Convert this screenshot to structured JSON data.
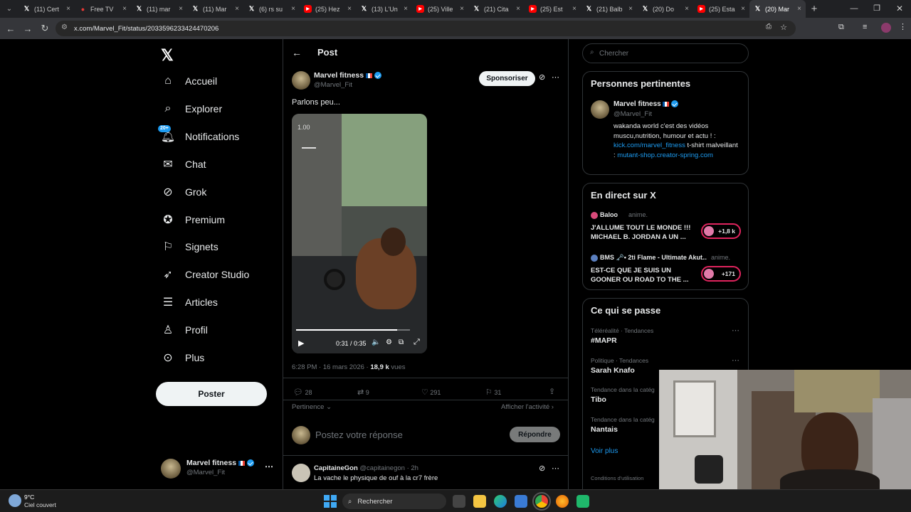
{
  "browser": {
    "tabs": [
      {
        "icon": "x-logo",
        "title": "(11) Cert"
      },
      {
        "icon": "freetv",
        "title": "Free TV"
      },
      {
        "icon": "x-logo",
        "title": "(11) mar"
      },
      {
        "icon": "x-logo",
        "title": "(11) Mar"
      },
      {
        "icon": "x-logo",
        "title": "(6) rs su"
      },
      {
        "icon": "youtube",
        "title": "(25) Hez"
      },
      {
        "icon": "x-logo",
        "title": "(13) L'Un"
      },
      {
        "icon": "youtube",
        "title": "(25) Ville"
      },
      {
        "icon": "x-logo",
        "title": "(21) Cita"
      },
      {
        "icon": "youtube",
        "title": "(25) Est"
      },
      {
        "icon": "x-logo",
        "title": "(21) Balb"
      },
      {
        "icon": "x-logo",
        "title": "(20) Do"
      },
      {
        "icon": "youtube",
        "title": "(25) Esta"
      },
      {
        "icon": "x-logo",
        "title": "(20) Mar"
      }
    ],
    "url": "x.com/Marvel_Fit/status/2033596233424470206"
  },
  "sidebar": {
    "items": [
      {
        "label": "Accueil",
        "icon": "home-icon"
      },
      {
        "label": "Explorer",
        "icon": "search-icon"
      },
      {
        "label": "Notifications",
        "icon": "bell-icon",
        "badge": "20+"
      },
      {
        "label": "Chat",
        "icon": "mail-icon"
      },
      {
        "label": "Grok",
        "icon": "grok-icon"
      },
      {
        "label": "Premium",
        "icon": "premium-icon"
      },
      {
        "label": "Signets",
        "icon": "bookmark-icon"
      },
      {
        "label": "Creator Studio",
        "icon": "rocket-icon"
      },
      {
        "label": "Articles",
        "icon": "article-icon"
      },
      {
        "label": "Profil",
        "icon": "profile-icon"
      },
      {
        "label": "Plus",
        "icon": "more-icon"
      }
    ],
    "post_button": "Poster",
    "account": {
      "name": "Marvel fitness",
      "handle": "@Marvel_Fit"
    }
  },
  "main": {
    "header": "Post",
    "author": {
      "name": "Marvel fitness",
      "handle": "@Marvel_Fit"
    },
    "sponsor_button": "Sponsoriser",
    "text": "Parlons peu...",
    "video": {
      "speed": "1.00",
      "time": "0:31 / 0:35",
      "progress": 0.89
    },
    "meta": {
      "date": "6:28 PM · 16 mars 2026 · ",
      "views_count": "18,9 k",
      "views_label": " vues"
    },
    "actions": {
      "replies": "28",
      "reposts": "9",
      "likes": "291",
      "bookmarks": "31"
    },
    "relevance": "Pertinence",
    "show_activity": "Afficher l'activité",
    "reply_placeholder": "Postez votre réponse",
    "reply_button": "Répondre",
    "comment": {
      "name": "CapitaineGon",
      "handle": "@capitainegon · 2h",
      "text": "La vache le physique de ouf à la cr7 frère"
    }
  },
  "right": {
    "search_placeholder": "Chercher",
    "people": {
      "title": "Personnes pertinentes",
      "name": "Marvel fitness",
      "handle": "@Marvel_Fit",
      "bio_1": "wakanda world c'est des vidéos muscu,nutrition, humour et actu ! : ",
      "bio_link1": "kick.com/marvel_fitness",
      "bio_2": " t-shirt malveillant : ",
      "bio_link2": "mutant-shop.creator-spring.com"
    },
    "live": {
      "title": "En direct sur X",
      "items": [
        {
          "host": "Baloo",
          "status": "anime.",
          "text": "J'ALLUME TOUT LE MONDE !!! MICHAEL B. JORDAN A UN ...",
          "count": "+1,8 k"
        },
        {
          "host": "BMS 🗝️• 2ti Flame - Ultimate Akut...",
          "status": "anime.",
          "text": "EST-CE QUE JE SUIS UN GOONER OU ROAD TO THE ...",
          "count": "+171"
        }
      ]
    },
    "trending": {
      "title": "Ce qui se passe",
      "items": [
        {
          "context": "Téléréalité · Tendances",
          "name": "#MAPR"
        },
        {
          "context": "Politique · Tendances",
          "name": "Sarah Knafo"
        },
        {
          "context": "Tendance dans la catég",
          "name": "Tibo"
        },
        {
          "context": "Tendance dans la catég",
          "name": "Nantais"
        }
      ],
      "show_more": "Voir plus"
    },
    "footer": "Conditions d'utilisation"
  },
  "taskbar": {
    "weather_temp": "9°C",
    "weather_desc": "Ciel couvert",
    "search": "Rechercher"
  }
}
